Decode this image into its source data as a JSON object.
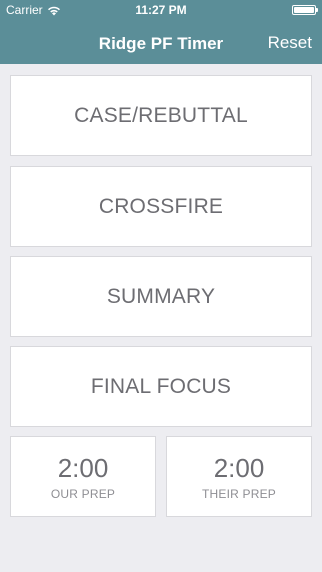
{
  "status_bar": {
    "carrier": "Carrier",
    "time": "11:27 PM"
  },
  "nav": {
    "title": "Ridge PF Timer",
    "reset_label": "Reset"
  },
  "phases": [
    {
      "label": "CASE/REBUTTAL"
    },
    {
      "label": "CROSSFIRE"
    },
    {
      "label": "SUMMARY"
    },
    {
      "label": "FINAL FOCUS"
    }
  ],
  "prep": {
    "ours": {
      "time": "2:00",
      "label": "OUR PREP"
    },
    "theirs": {
      "time": "2:00",
      "label": "THEIR PREP"
    }
  },
  "colors": {
    "nav_background": "#5b8e98",
    "page_background": "#ededf1",
    "card_text": "#6d6d72"
  }
}
